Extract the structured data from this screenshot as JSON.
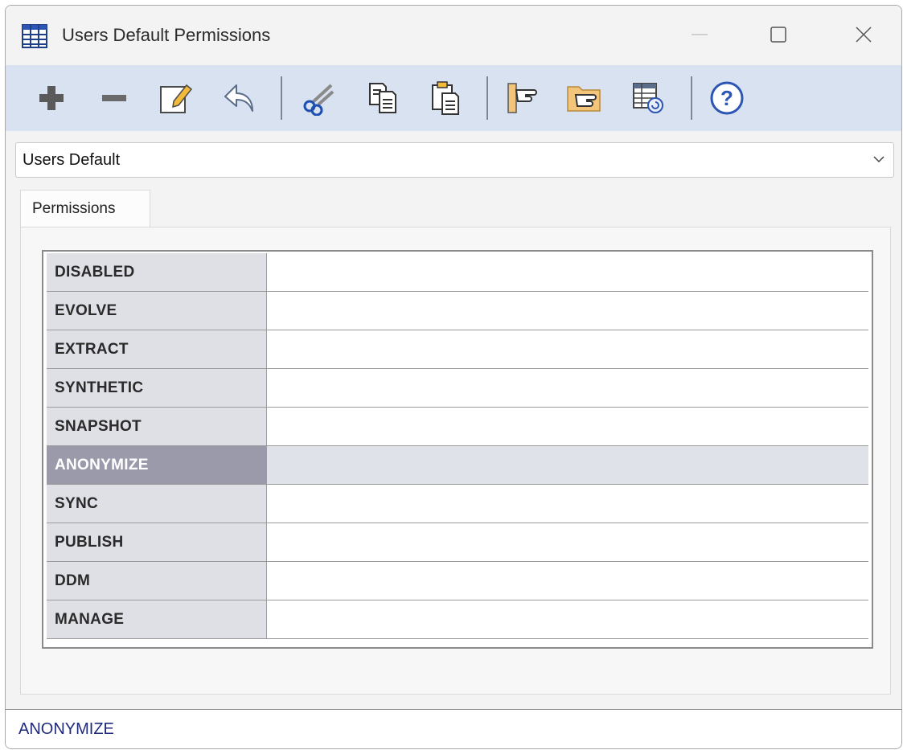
{
  "window": {
    "title": "Users Default Permissions",
    "controls": [
      "minimize",
      "maximize",
      "close"
    ]
  },
  "toolbar": {
    "buttons": [
      {
        "name": "add",
        "icon": "plus-icon"
      },
      {
        "name": "remove",
        "icon": "minus-icon"
      },
      {
        "name": "edit",
        "icon": "edit-icon"
      },
      {
        "name": "undo",
        "icon": "undo-icon"
      },
      {
        "name": "cut",
        "icon": "scissors-icon"
      },
      {
        "name": "copy",
        "icon": "copy-icon"
      },
      {
        "name": "paste",
        "icon": "paste-icon"
      },
      {
        "name": "move-out",
        "icon": "pointing-hand-icon"
      },
      {
        "name": "move-into-folder",
        "icon": "folder-hand-icon"
      },
      {
        "name": "refresh-table",
        "icon": "table-refresh-icon"
      },
      {
        "name": "help",
        "icon": "help-icon"
      }
    ]
  },
  "selector": {
    "value": "Users Default"
  },
  "tabs": [
    {
      "label": "Permissions",
      "active": true
    }
  ],
  "permissions": {
    "rows": [
      {
        "name": "DISABLED",
        "value": ""
      },
      {
        "name": "EVOLVE",
        "value": ""
      },
      {
        "name": "EXTRACT",
        "value": ""
      },
      {
        "name": "SYNTHETIC",
        "value": ""
      },
      {
        "name": "SNAPSHOT",
        "value": ""
      },
      {
        "name": "ANONYMIZE",
        "value": "",
        "selected": true
      },
      {
        "name": "SYNC",
        "value": ""
      },
      {
        "name": "PUBLISH",
        "value": ""
      },
      {
        "name": "DDM",
        "value": ""
      },
      {
        "name": "MANAGE",
        "value": ""
      }
    ]
  },
  "status": {
    "text": "ANONYMIZE"
  },
  "colors": {
    "toolbar_bg": "#d9e2f0",
    "row_header_bg": "#dfdfe6",
    "selected_header_bg": "#9b9aab",
    "selected_value_bg": "#e0e2ea",
    "status_text": "#1f2a7a"
  }
}
